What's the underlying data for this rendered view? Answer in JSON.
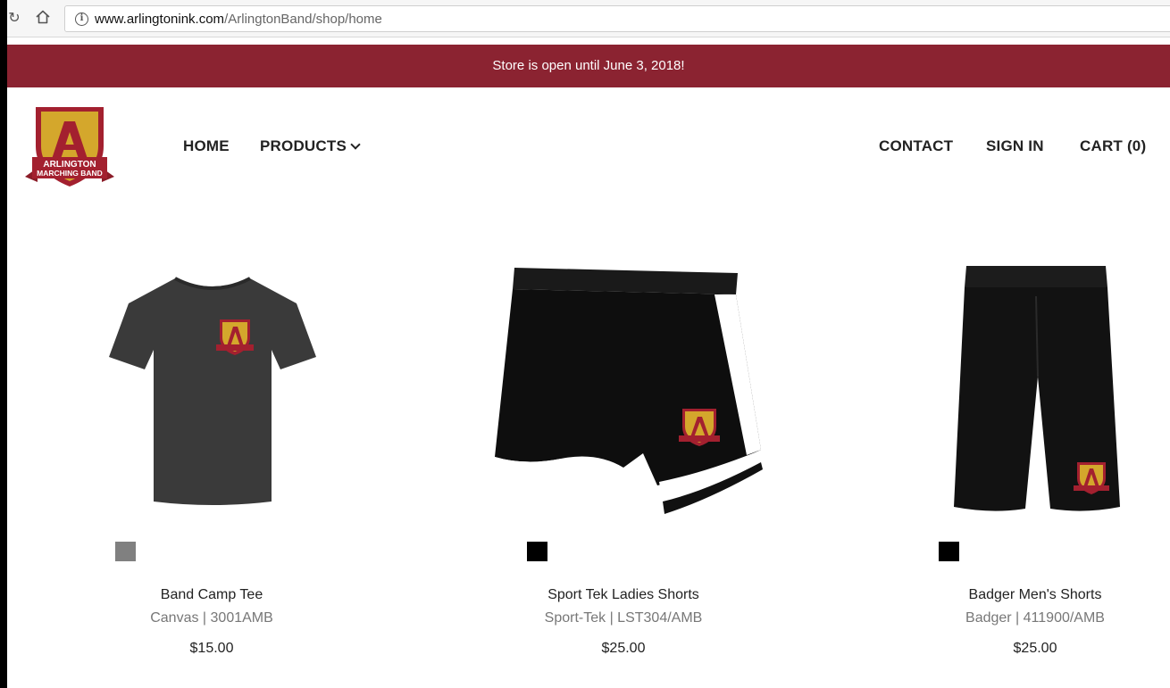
{
  "browser": {
    "reload_icon": "reload-icon",
    "home_icon": "home-icon",
    "info_icon": "info-icon",
    "url_host": "www.arlingtonink.com",
    "url_path": "/ArlingtonBand/shop/home"
  },
  "banner": {
    "text": "Store is open until June 3, 2018!",
    "color": "#8b2331"
  },
  "logo": {
    "line1": "ARLINGTON",
    "line2": "MARCHING BAND",
    "colors": {
      "crimson": "#a3202f",
      "gold": "#d4a72c"
    }
  },
  "nav": {
    "left": [
      {
        "label": "HOME"
      },
      {
        "label": "PRODUCTS",
        "icon": "chevron-down-icon"
      }
    ],
    "right": [
      {
        "label": "CONTACT"
      },
      {
        "label": "SIGN IN"
      },
      {
        "label": "CART (0)"
      }
    ]
  },
  "products": [
    {
      "name": "Band Camp Tee",
      "meta": "Canvas | 3001AMB",
      "price": "$15.00",
      "swatch": "#808080",
      "image": "t-shirt"
    },
    {
      "name": "Sport Tek Ladies Shorts",
      "meta": "Sport-Tek | LST304/AMB",
      "price": "$25.00",
      "swatch": "#000000",
      "image": "ladies-shorts"
    },
    {
      "name": "Badger Men's Shorts",
      "meta": "Badger | 411900/AMB",
      "price": "$25.00",
      "swatch": "#000000",
      "image": "mens-shorts"
    }
  ]
}
